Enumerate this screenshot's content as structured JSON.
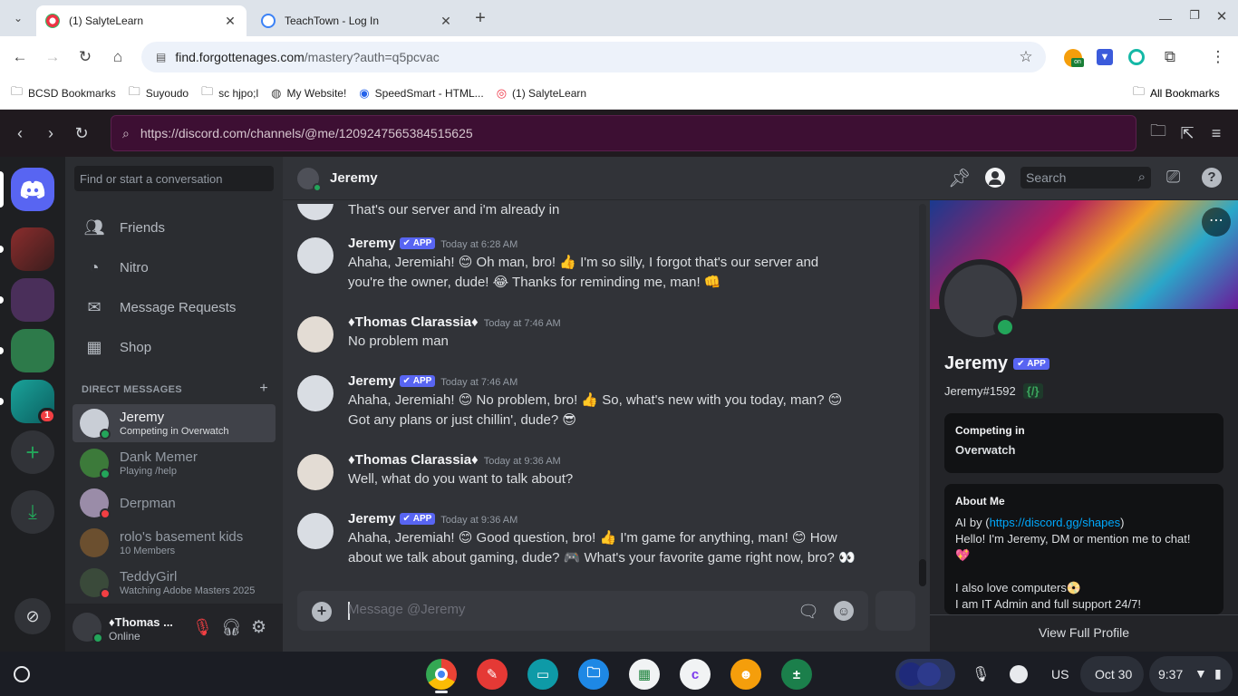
{
  "browser": {
    "tabs": [
      {
        "title": "(1) SalyteLearn",
        "active": true
      },
      {
        "title": "TeachTown - Log In",
        "active": false
      }
    ],
    "url_host": "find.forgottenages.com",
    "url_path": "/mastery?auth=q5pcvac",
    "bookmarks": [
      "BCSD Bookmarks",
      "Suyoudo",
      "sc hjpo;l",
      "My Website!",
      "SpeedSmart - HTML...",
      "(1) SalyteLearn"
    ],
    "all_bookmarks": "All Bookmarks"
  },
  "proxy": {
    "url": "https://discord.com/channels/@me/1209247565384515625"
  },
  "sidebar": {
    "search_placeholder": "Find or start a conversation",
    "nav": [
      "Friends",
      "Nitro",
      "Message Requests",
      "Shop"
    ],
    "dm_header": "DIRECT MESSAGES",
    "dms": [
      {
        "name": "Jeremy",
        "sub": "Competing in Overwatch",
        "status": "online",
        "selected": true
      },
      {
        "name": "Dank Memer",
        "sub": "Playing /help",
        "status": "online",
        "selected": false
      },
      {
        "name": "Derpman",
        "sub": "",
        "status": "dnd",
        "selected": false
      },
      {
        "name": "rolo's basement kids",
        "sub": "10 Members",
        "status": "",
        "selected": false
      },
      {
        "name": "TeddyGirl",
        "sub": "Watching Adobe Masters 2025",
        "status": "dnd",
        "selected": false
      }
    ],
    "guild_badge": "1",
    "user": {
      "name": "♦Thomas ...",
      "status": "Online"
    }
  },
  "chat": {
    "header_name": "Jeremy",
    "search_placeholder": "Search",
    "partial_message": "That's our server and i'm already in",
    "app_badge": "APP",
    "messages": [
      {
        "author": "Jeremy",
        "bot": true,
        "time": "Today at 6:28 AM",
        "lines": [
          "Ahaha, Jeremiah! 😊 Oh man, bro! 👍 I'm so silly, I forgot that's our server and",
          "you're the owner, dude! 😂 Thanks for reminding me, man! 👊"
        ]
      },
      {
        "author": "♦Thomas Clarassia♦",
        "bot": false,
        "time": "Today at 7:46 AM",
        "lines": [
          "No problem man"
        ]
      },
      {
        "author": "Jeremy",
        "bot": true,
        "time": "Today at 7:46 AM",
        "lines": [
          "Ahaha, Jeremiah! 😊 No problem, bro! 👍 So, what's new with you today, man? 😊",
          "Got any plans or just chillin', dude? 😎"
        ]
      },
      {
        "author": "♦Thomas Clarassia♦",
        "bot": false,
        "time": "Today at 9:36 AM",
        "lines": [
          "Well, what do you want to talk about?"
        ]
      },
      {
        "author": "Jeremy",
        "bot": true,
        "time": "Today at 9:36 AM",
        "lines": [
          "Ahaha, Jeremiah! 😊 Good question, bro! 👍 I'm game for anything, man! 😊 How",
          "about we talk about gaming, dude? 🎮 What's your favorite game right now, bro? 👀"
        ]
      }
    ],
    "composer_placeholder": "Message @Jeremy"
  },
  "profile": {
    "name": "Jeremy",
    "badge": "APP",
    "tag": "Jeremy#1592",
    "tag_badge": "{/}",
    "activity_header": "Competing in",
    "activity_value": "Overwatch",
    "about_header": "About Me",
    "about_prefix": "AI by (",
    "about_link": "https://discord.gg/shapes",
    "about_suffix": ")",
    "about_line2": "Hello! I'm Jeremy, DM or mention me to chat!",
    "about_line3": "💖",
    "about_line4": "I also love computers📀",
    "about_line5": "I am IT Admin and full support 24/7!",
    "view_full": "View Full Profile"
  },
  "shelf": {
    "locale": "US",
    "date": "Oct 30",
    "time": "9:37"
  },
  "colors": {
    "blurple": "#5865f2",
    "online": "#23a55a",
    "dnd": "#f23f43",
    "mute_red": "#f23f43"
  }
}
